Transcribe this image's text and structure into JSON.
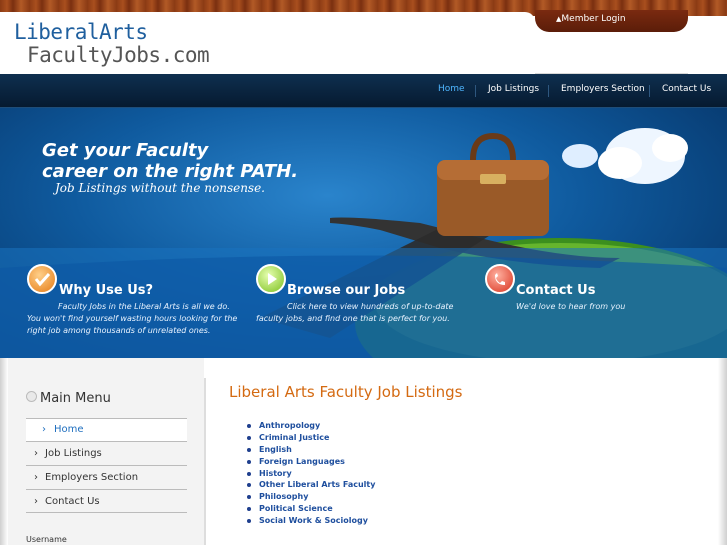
{
  "logo": {
    "line1": "LiberalArts",
    "line2": "FacultyJobs.com"
  },
  "header": {
    "member_login": "Member Login"
  },
  "nav": {
    "items": [
      {
        "label": "Home",
        "active": true
      },
      {
        "label": "Job Listings",
        "active": false
      },
      {
        "label": "Employers Section",
        "active": false
      },
      {
        "label": "Contact Us",
        "active": false
      }
    ]
  },
  "hero": {
    "headline1": "Get your Faculty",
    "headline2": "career on the right PATH.",
    "tagline": "Job Listings without the nonsense."
  },
  "features": [
    {
      "title": "Why Use Us?",
      "lines": [
        "Faculty Jobs in the Liberal Arts is all we do.",
        "You won't find yourself wasting hours looking for the",
        "right job among thousands of unrelated ones."
      ]
    },
    {
      "title": "Browse our Jobs",
      "lines": [
        "Click here to view hundreds of up-to-date",
        "faculty jobs, and find one that is perfect for you."
      ]
    },
    {
      "title": "Contact Us",
      "lines": [
        "We'd love to hear from you"
      ]
    }
  ],
  "sidebar": {
    "title": "Main Menu",
    "items": [
      {
        "label": "Home",
        "active": true
      },
      {
        "label": "Job Listings"
      },
      {
        "label": "Employers Section"
      },
      {
        "label": "Contact Us"
      }
    ],
    "username_label": "Username"
  },
  "main": {
    "title": "Liberal Arts Faculty Job Listings",
    "listings": [
      "Anthropology",
      "Criminal Justice",
      "English",
      "Foreign Languages",
      "History",
      "Other Liberal Arts Faculty",
      "Philosophy",
      "Political Science",
      "Social Work & Sociology"
    ]
  },
  "colors": {
    "accent_orange": "#d46a12",
    "link_blue": "#1f4f9e",
    "nav_active": "#4fb6ff",
    "nav_bg": "#0e2f4f"
  }
}
